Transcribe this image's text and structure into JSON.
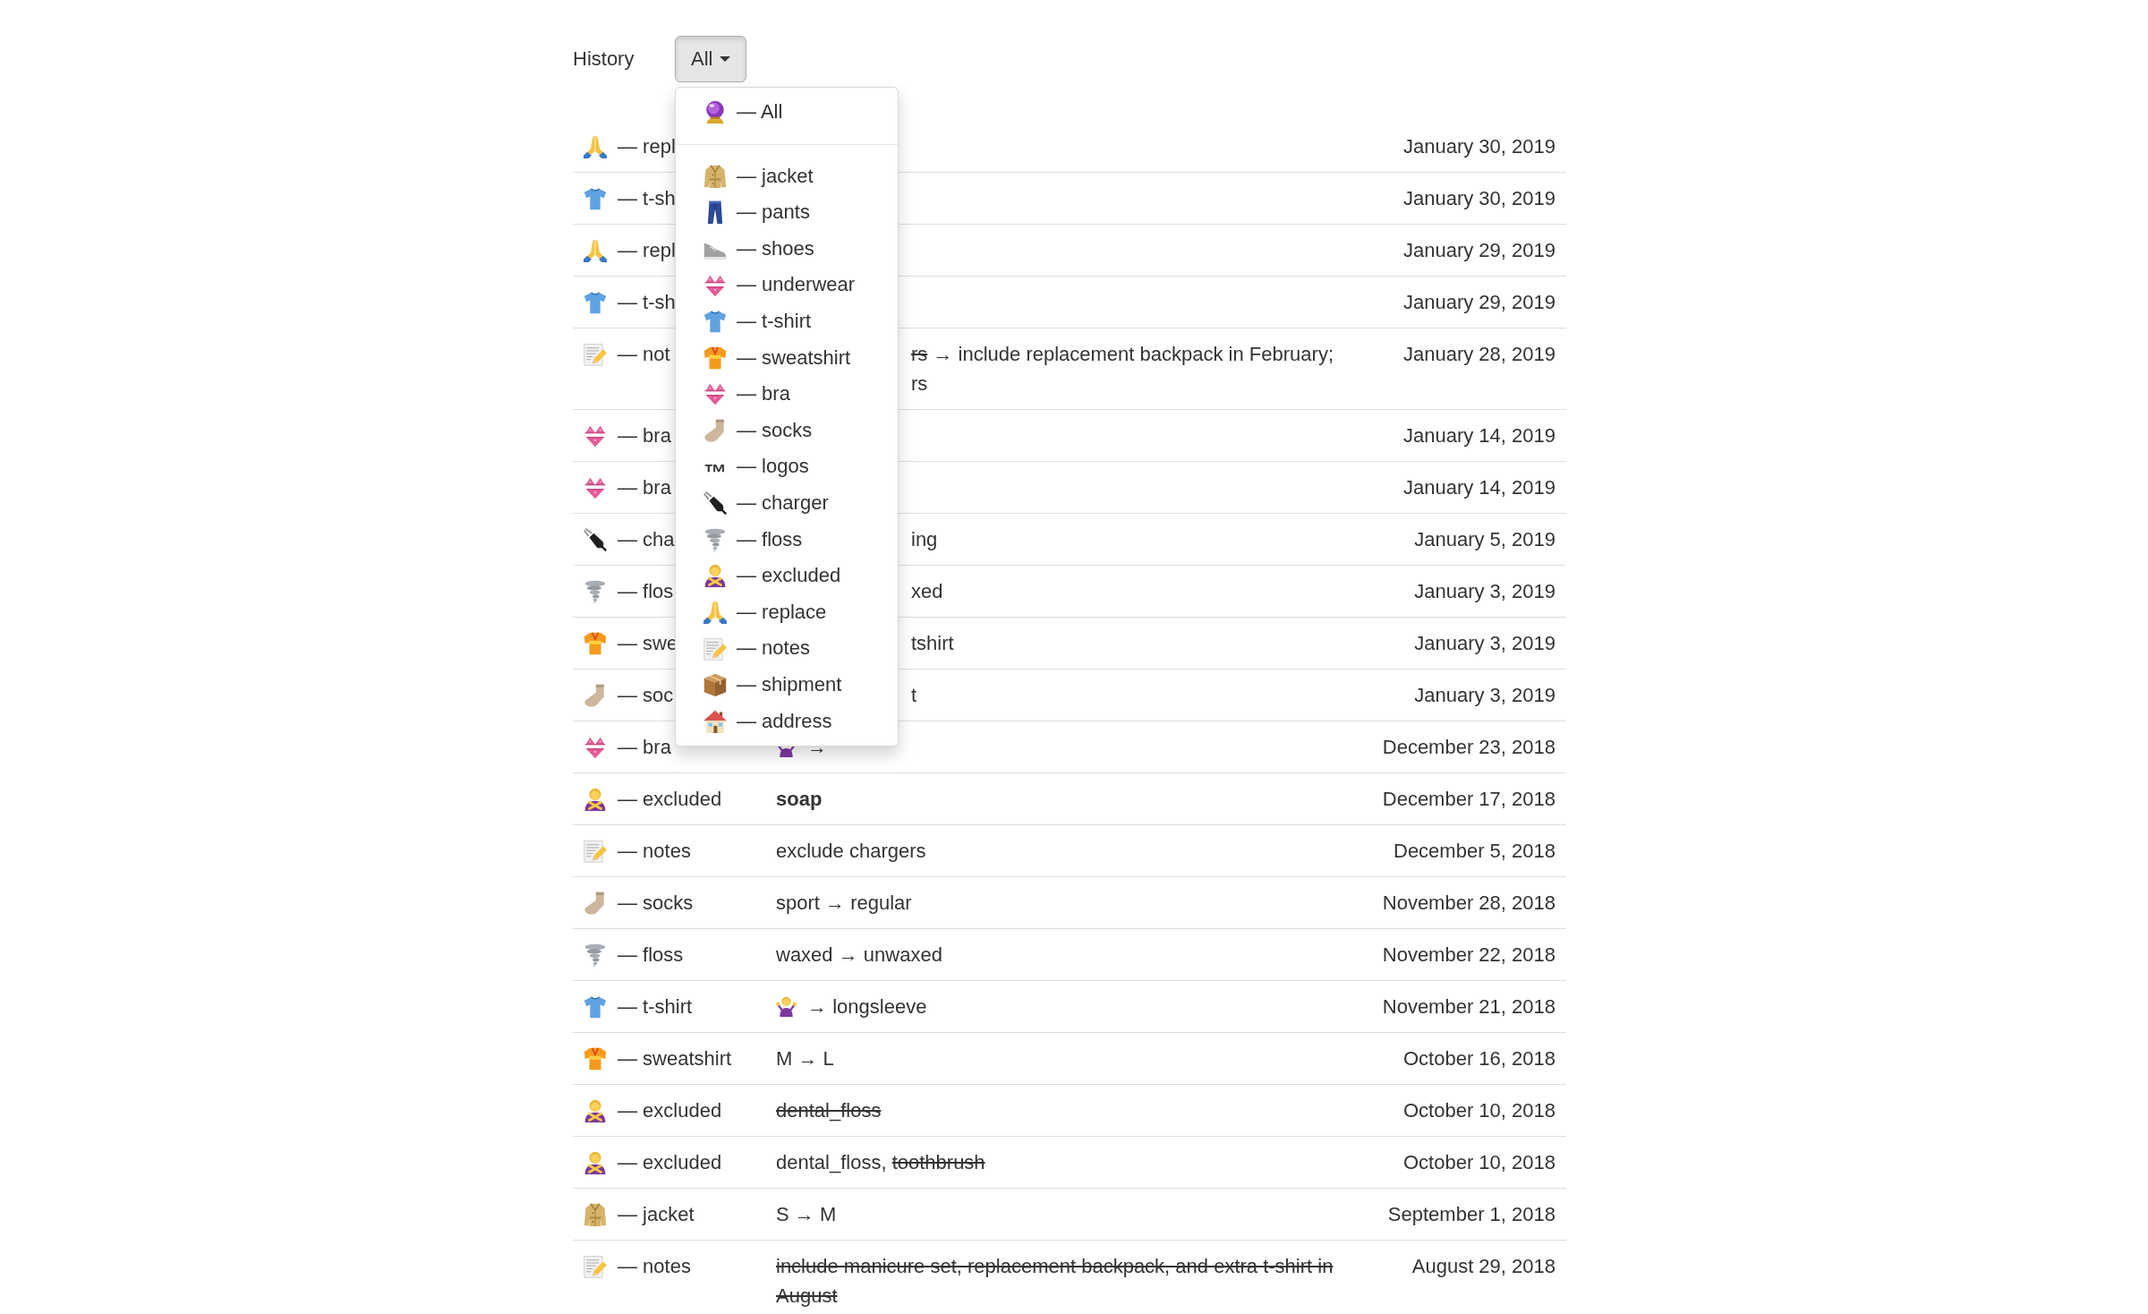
{
  "history": {
    "title": "History",
    "filter": {
      "value": "All",
      "open": true,
      "menu": [
        {
          "kind": "all",
          "label": "— All"
        },
        {
          "kind": "divider"
        },
        {
          "kind": "jacket",
          "label": "— jacket"
        },
        {
          "kind": "pants",
          "label": "— pants"
        },
        {
          "kind": "shoes",
          "label": "— shoes"
        },
        {
          "kind": "underwear",
          "label": "— underwear"
        },
        {
          "kind": "tshirt",
          "label": "— t-shirt"
        },
        {
          "kind": "sweatshirt",
          "label": "— sweatshirt"
        },
        {
          "kind": "bra",
          "label": "— bra"
        },
        {
          "kind": "socks",
          "label": "— socks"
        },
        {
          "kind": "logos",
          "glyph": "™",
          "label": "— logos"
        },
        {
          "kind": "charger",
          "label": "— charger"
        },
        {
          "kind": "floss",
          "label": "— floss"
        },
        {
          "kind": "excluded",
          "label": "— excluded"
        },
        {
          "kind": "replace",
          "label": "— replace"
        },
        {
          "kind": "notes",
          "label": "— notes"
        },
        {
          "kind": "shipment",
          "label": "— shipment"
        },
        {
          "kind": "address",
          "label": "— address"
        }
      ]
    }
  },
  "table": {
    "rows": [
      {
        "kind": "replace",
        "label": "— repl",
        "date": "January 30, 2019"
      },
      {
        "kind": "tshirt",
        "label": "— t-sh",
        "date": "January 30, 2019"
      },
      {
        "kind": "replace",
        "label": "— repl",
        "date": "January 29, 2019"
      },
      {
        "kind": "tshirt",
        "label": "— t-sh",
        "date": "January 29, 2019"
      },
      {
        "kind": "notes",
        "label": "— not",
        "description_past_menu": [
          [
            {
              "kind": "struck",
              "text": "rs"
            },
            {
              "kind": "plain",
              "text": " → include replacement backpack in February;"
            }
          ],
          [
            {
              "kind": "plain",
              "text": "rs"
            }
          ]
        ],
        "date": "January 28, 2019"
      },
      {
        "kind": "bra",
        "label": "— bra",
        "date": "January 14, 2019"
      },
      {
        "kind": "bra",
        "label": "— bra",
        "date": "January 14, 2019"
      },
      {
        "kind": "charger",
        "label": "— cha",
        "description_past_menu": [
          [
            {
              "kind": "plain",
              "text": "ing"
            }
          ]
        ],
        "date": "January 5, 2019"
      },
      {
        "kind": "floss",
        "label": "— flos",
        "description_past_menu": [
          [
            {
              "kind": "plain",
              "text": "xed"
            }
          ]
        ],
        "date": "January 3, 2019"
      },
      {
        "kind": "sweatshirt",
        "label": "— swe",
        "description_past_menu": [
          [
            {
              "kind": "plain",
              "text": "tshirt"
            }
          ]
        ],
        "date": "January 3, 2019"
      },
      {
        "kind": "socks",
        "label": "— soc",
        "description_past_menu": [
          [
            {
              "kind": "plain",
              "text": "t"
            }
          ]
        ],
        "date": "January 3, 2019"
      },
      {
        "kind": "bra",
        "label": "— bra",
        "description": [
          [
            {
              "kind": "unspecified"
            },
            {
              "kind": "plain",
              "text": " →"
            }
          ]
        ],
        "date": "December 23, 2018"
      },
      {
        "kind": "excluded",
        "label": "— excluded",
        "description": [
          [
            {
              "kind": "strong",
              "text": "soap"
            }
          ]
        ],
        "date": "December 17, 2018"
      },
      {
        "kind": "notes",
        "label": "— notes",
        "description": [
          [
            {
              "kind": "plain",
              "text": "exclude chargers"
            }
          ]
        ],
        "date": "December 5, 2018"
      },
      {
        "kind": "socks",
        "label": "— socks",
        "description": [
          [
            {
              "kind": "plain",
              "text": "sport → regular"
            }
          ]
        ],
        "date": "November 28, 2018"
      },
      {
        "kind": "floss",
        "label": "— floss",
        "description": [
          [
            {
              "kind": "plain",
              "text": "waxed → unwaxed"
            }
          ]
        ],
        "date": "November 22, 2018"
      },
      {
        "kind": "tshirt",
        "label": "— t-shirt",
        "description": [
          [
            {
              "kind": "unspecified"
            },
            {
              "kind": "plain",
              "text": " → longsleeve"
            }
          ]
        ],
        "date": "November 21, 2018"
      },
      {
        "kind": "sweatshirt",
        "label": "— sweatshirt",
        "description": [
          [
            {
              "kind": "plain",
              "text": "M → L"
            }
          ]
        ],
        "date": "October 16, 2018"
      },
      {
        "kind": "excluded",
        "label": "— excluded",
        "description": [
          [
            {
              "kind": "struck",
              "text": "dental_floss"
            }
          ]
        ],
        "date": "October 10, 2018"
      },
      {
        "kind": "excluded",
        "label": "— excluded",
        "description": [
          [
            {
              "kind": "plain",
              "text": "dental_floss, "
            },
            {
              "kind": "struck",
              "text": "toothbrush"
            }
          ]
        ],
        "date": "October 10, 2018"
      },
      {
        "kind": "jacket",
        "label": "— jacket",
        "description": [
          [
            {
              "kind": "plain",
              "text": "S → M"
            }
          ]
        ],
        "date": "September 1, 2018"
      },
      {
        "kind": "notes",
        "label": "— notes",
        "description": [
          [
            {
              "kind": "struck",
              "text": "include manicure set, replacement backpack, and extra t-shirt in August"
            }
          ]
        ],
        "date": "August 29, 2018"
      }
    ]
  }
}
